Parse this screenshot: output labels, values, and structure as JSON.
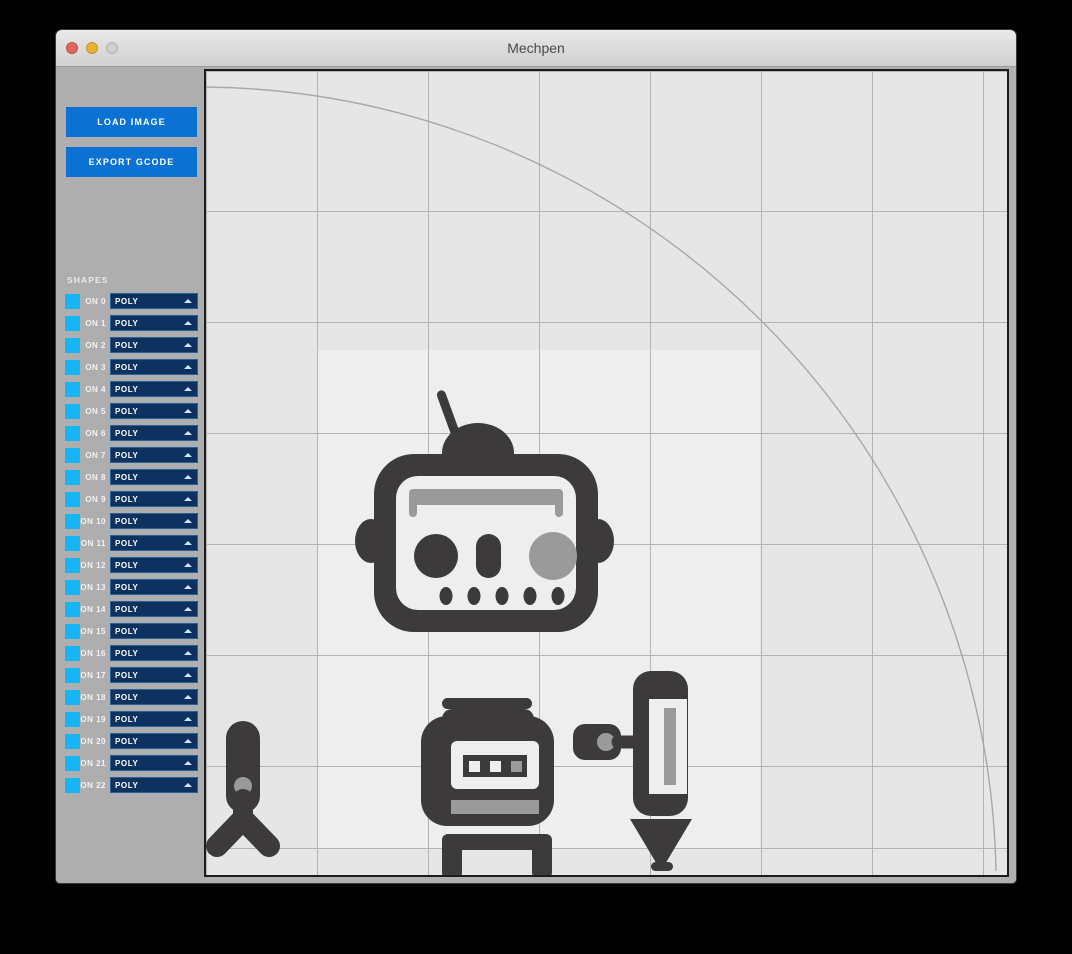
{
  "window": {
    "title": "Mechpen",
    "traffic_lights": [
      {
        "name": "close-button",
        "color": "#e2655b"
      },
      {
        "name": "minimize-button",
        "color": "#e8b233"
      },
      {
        "name": "zoom-button",
        "color": "#cfcfcf"
      }
    ]
  },
  "sidebar": {
    "load_image_label": "LOAD IMAGE",
    "export_gcode_label": "EXPORT GCODE",
    "shapes_heading": "SHAPES",
    "accent_button_color": "#0b72d4",
    "swatch_color": "#16b5f5",
    "select_color": "#0e3260",
    "shapes": [
      {
        "toggle_label": "ON 0",
        "type": "POLY"
      },
      {
        "toggle_label": "ON 1",
        "type": "POLY"
      },
      {
        "toggle_label": "ON 2",
        "type": "POLY"
      },
      {
        "toggle_label": "ON 3",
        "type": "POLY"
      },
      {
        "toggle_label": "ON 4",
        "type": "POLY"
      },
      {
        "toggle_label": "ON 5",
        "type": "POLY"
      },
      {
        "toggle_label": "ON 6",
        "type": "POLY"
      },
      {
        "toggle_label": "ON 7",
        "type": "POLY"
      },
      {
        "toggle_label": "ON 8",
        "type": "POLY"
      },
      {
        "toggle_label": "ON 9",
        "type": "POLY"
      },
      {
        "toggle_label": "ON 10",
        "type": "POLY"
      },
      {
        "toggle_label": "ON 11",
        "type": "POLY"
      },
      {
        "toggle_label": "ON 12",
        "type": "POLY"
      },
      {
        "toggle_label": "ON 13",
        "type": "POLY"
      },
      {
        "toggle_label": "ON 14",
        "type": "POLY"
      },
      {
        "toggle_label": "ON 15",
        "type": "POLY"
      },
      {
        "toggle_label": "ON 16",
        "type": "POLY"
      },
      {
        "toggle_label": "ON 17",
        "type": "POLY"
      },
      {
        "toggle_label": "ON 18",
        "type": "POLY"
      },
      {
        "toggle_label": "ON 19",
        "type": "POLY"
      },
      {
        "toggle_label": "ON 20",
        "type": "POLY"
      },
      {
        "toggle_label": "ON 21",
        "type": "POLY"
      },
      {
        "toggle_label": "ON 22",
        "type": "POLY"
      }
    ]
  },
  "canvas": {
    "background_color": "#e6e6e6",
    "paper_color": "#eeeeee",
    "grid_line_color": "#b3b3b3",
    "grid_spacing_px": 111,
    "arc_color": "#a8a8a8",
    "artwork_dark": "#3c3a3b",
    "artwork_gray": "#9a9a9a",
    "artwork_light": "#eeeeee"
  }
}
